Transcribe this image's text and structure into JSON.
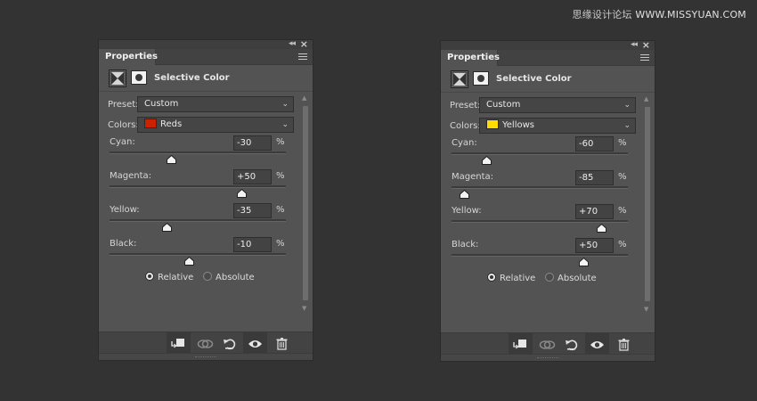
{
  "watermark": {
    "text": "思缘设计论坛",
    "site": "WWW.MISSYUAN.COM"
  },
  "panels": [
    {
      "tab_label": "Properties",
      "title": "Selective Color",
      "preset_label": "Preset:",
      "preset_value": "Custom",
      "colors_label": "Colors:",
      "colors_value": "Reds",
      "colors_swatch": "#cc2200",
      "sliders": [
        {
          "label": "Cyan:",
          "value": "-30",
          "pct": "%",
          "level": -30
        },
        {
          "label": "Magenta:",
          "value": "+50",
          "pct": "%",
          "level": 50
        },
        {
          "label": "Yellow:",
          "value": "-35",
          "pct": "%",
          "level": -35
        },
        {
          "label": "Black:",
          "value": "-10",
          "pct": "%",
          "level": -10
        }
      ],
      "relative_label": "Relative",
      "absolute_label": "Absolute",
      "relative_selected": true
    },
    {
      "tab_label": "Properties",
      "title": "Selective Color",
      "preset_label": "Preset:",
      "preset_value": "Custom",
      "colors_label": "Colors:",
      "colors_value": "Yellows",
      "colors_swatch": "#ffdd00",
      "sliders": [
        {
          "label": "Cyan:",
          "value": "-60",
          "pct": "%",
          "level": -60
        },
        {
          "label": "Magenta:",
          "value": "-85",
          "pct": "%",
          "level": -85
        },
        {
          "label": "Yellow:",
          "value": "+70",
          "pct": "%",
          "level": 70
        },
        {
          "label": "Black:",
          "value": "+50",
          "pct": "%",
          "level": 50
        }
      ],
      "relative_label": "Relative",
      "absolute_label": "Absolute",
      "relative_selected": true
    }
  ],
  "icons": {
    "collapse": "double-chevron-left-icon",
    "close": "close-icon",
    "menu": "panel-menu-icon",
    "adjustment": "selective-color-adjustment-icon",
    "mask": "layer-mask-icon",
    "clip": "clip-to-layer-icon",
    "view_previous": "view-previous-state-icon",
    "reset": "reset-icon",
    "visibility": "eye-icon",
    "delete": "trash-icon"
  }
}
